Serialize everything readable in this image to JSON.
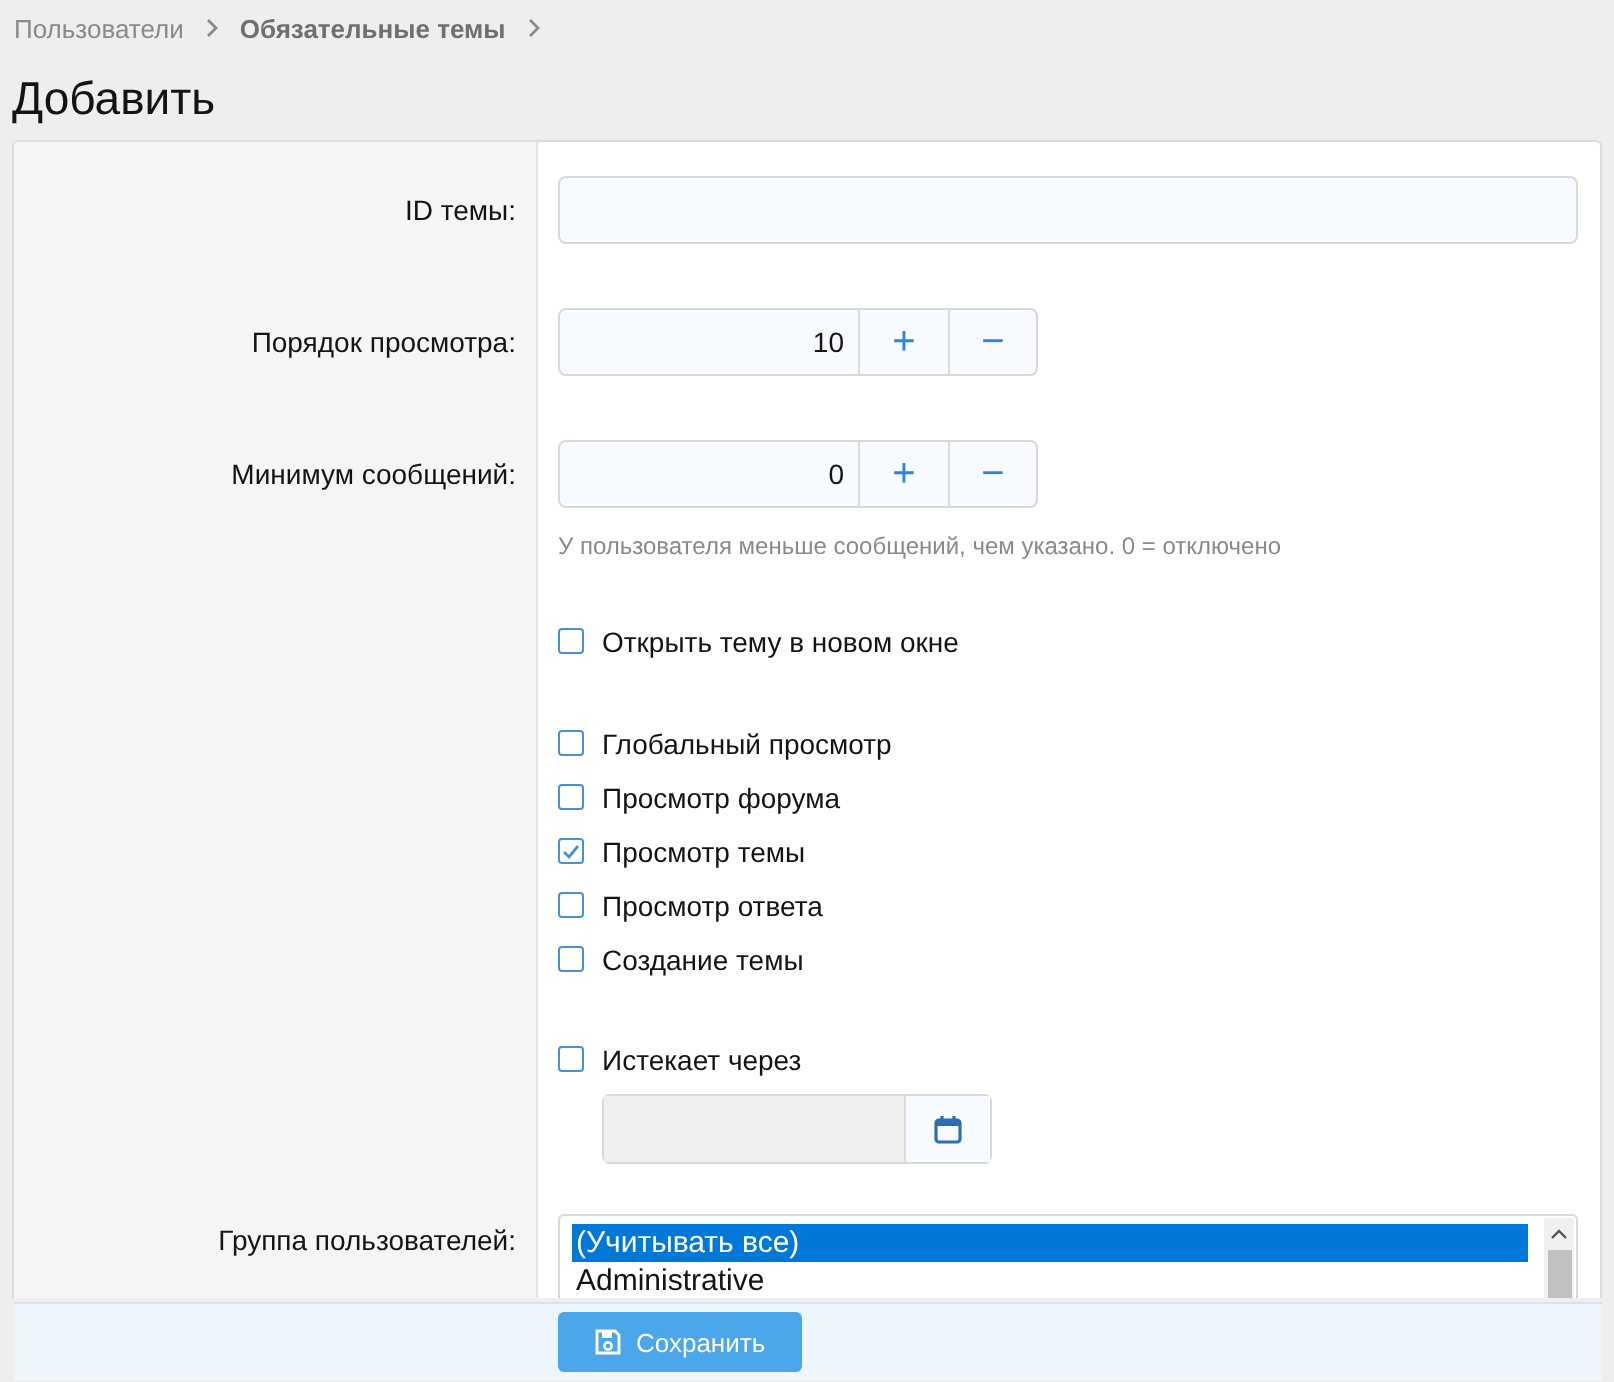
{
  "breadcrumb": [
    {
      "label": "Пользователи",
      "selected": false
    },
    {
      "label": "Обязательные темы",
      "selected": true
    }
  ],
  "title": "Добавить",
  "thread_id": {
    "label": "ID темы:"
  },
  "display_order": {
    "label": "Порядок просмотра:",
    "value": "10",
    "plus": "+",
    "minus": "−"
  },
  "min_messages": {
    "label": "Минимум сообщений:",
    "value": "0",
    "plus": "+",
    "minus": "−",
    "hint": "У пользователя меньше сообщений, чем указано. 0 = отключено"
  },
  "open_new_window": {
    "label": "Открыть тему в новом окне",
    "checked": false
  },
  "views": [
    {
      "label": "Глобальный просмотр",
      "checked": false
    },
    {
      "label": "Просмотр форума",
      "checked": false
    },
    {
      "label": "Просмотр темы",
      "checked": true
    },
    {
      "label": "Просмотр ответа",
      "checked": false
    },
    {
      "label": "Создание темы",
      "checked": false
    }
  ],
  "expires": {
    "label": "Истекает через",
    "checked": false
  },
  "user_groups": {
    "label": "Группа пользователей:",
    "items": [
      {
        "label": "(Учитывать все)",
        "selected": true
      },
      {
        "label": "Administrative",
        "selected": false
      }
    ]
  },
  "save_button": "Сохранить"
}
